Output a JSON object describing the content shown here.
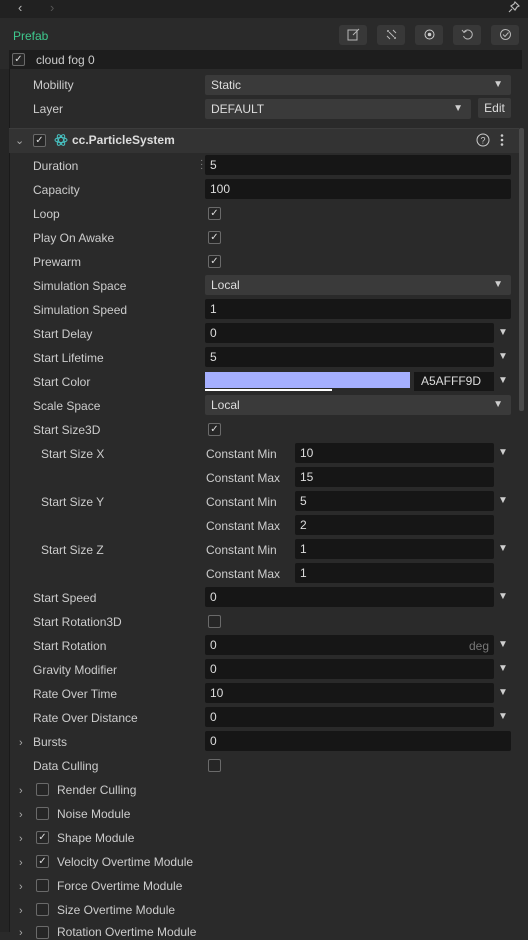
{
  "header": {
    "back_icon": "‹",
    "forward_icon": "›",
    "pin_icon": "📌",
    "prefab_label": "Prefab",
    "node_name": "cloud fog 0",
    "node_enabled": true
  },
  "node_props": {
    "mobility_label": "Mobility",
    "mobility_value": "Static",
    "layer_label": "Layer",
    "layer_value": "DEFAULT",
    "edit_label": "Edit"
  },
  "component": {
    "name": "cc.ParticleSystem",
    "enabled": true,
    "accent_color": "#47c2c2"
  },
  "props": {
    "duration_label": "Duration",
    "duration_value": "5",
    "capacity_label": "Capacity",
    "capacity_value": "100",
    "loop_label": "Loop",
    "loop_checked": true,
    "play_on_awake_label": "Play On Awake",
    "play_on_awake_checked": true,
    "prewarm_label": "Prewarm",
    "prewarm_checked": true,
    "simulation_space_label": "Simulation Space",
    "simulation_space_value": "Local",
    "simulation_speed_label": "Simulation Speed",
    "simulation_speed_value": "1",
    "start_delay_label": "Start Delay",
    "start_delay_value": "0",
    "start_lifetime_label": "Start Lifetime",
    "start_lifetime_value": "5",
    "start_color_label": "Start Color",
    "start_color_hex": "A5AFFF9D",
    "start_color_swatch": "#a5afff",
    "scale_space_label": "Scale Space",
    "scale_space_value": "Local",
    "start_size3d_label": "Start Size3D",
    "start_size3d_checked": true,
    "start_size_x_label": "Start Size X",
    "start_size_y_label": "Start Size Y",
    "start_size_z_label": "Start Size Z",
    "constant_min_label": "Constant Min",
    "constant_max_label": "Constant Max",
    "size_x_min": "10",
    "size_x_max": "15",
    "size_y_min": "5",
    "size_y_max": "2",
    "size_z_min": "1",
    "size_z_max": "1",
    "start_speed_label": "Start Speed",
    "start_speed_value": "0",
    "start_rotation3d_label": "Start Rotation3D",
    "start_rotation3d_checked": false,
    "start_rotation_label": "Start Rotation",
    "start_rotation_value": "0",
    "start_rotation_unit": "deg",
    "gravity_modifier_label": "Gravity Modifier",
    "gravity_modifier_value": "0",
    "rate_over_time_label": "Rate Over Time",
    "rate_over_time_value": "10",
    "rate_over_distance_label": "Rate Over Distance",
    "rate_over_distance_value": "0",
    "bursts_label": "Bursts",
    "bursts_value": "0",
    "data_culling_label": "Data Culling",
    "data_culling_checked": false
  },
  "modules": [
    {
      "label": "Render Culling",
      "checked": false
    },
    {
      "label": "Noise Module",
      "checked": false
    },
    {
      "label": "Shape Module",
      "checked": true
    },
    {
      "label": "Velocity Overtime Module",
      "checked": true
    },
    {
      "label": "Force Overtime Module",
      "checked": false
    },
    {
      "label": "Size Overtime Module",
      "checked": false
    },
    {
      "label": "Rotation Overtime Module",
      "checked": false
    }
  ]
}
